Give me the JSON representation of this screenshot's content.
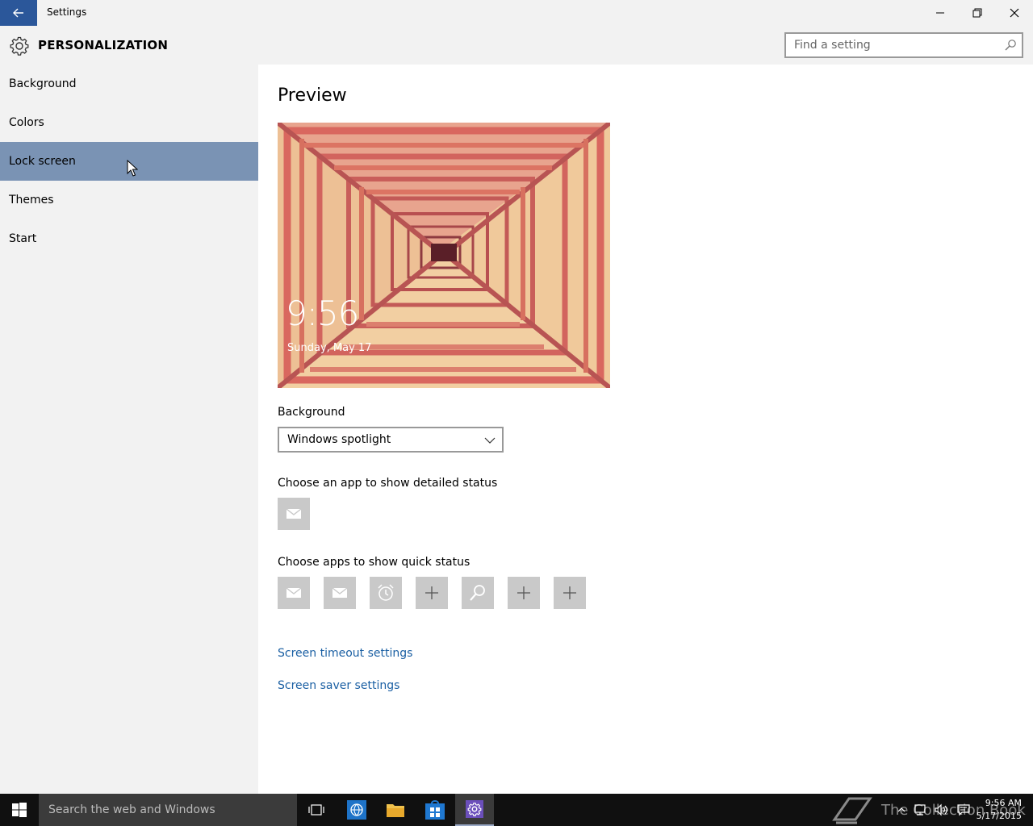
{
  "window": {
    "title": "Settings"
  },
  "header": {
    "section_title": "PERSONALIZATION",
    "search_placeholder": "Find a setting"
  },
  "sidebar": {
    "items": [
      {
        "label": "Background",
        "selected": false
      },
      {
        "label": "Colors",
        "selected": false
      },
      {
        "label": "Lock screen",
        "selected": true
      },
      {
        "label": "Themes",
        "selected": false
      },
      {
        "label": "Start",
        "selected": false
      }
    ]
  },
  "main": {
    "preview_title": "Preview",
    "preview_time": "9:56",
    "preview_date": "Sunday, May 17",
    "background_label": "Background",
    "background_value": "Windows spotlight",
    "detailed_status_label": "Choose an app to show detailed status",
    "detailed_status_apps": [
      "mail-icon"
    ],
    "quick_status_label": "Choose apps to show quick status",
    "quick_status_apps": [
      "mail-icon",
      "mail-icon",
      "alarm-icon",
      "plus-icon",
      "search-icon",
      "plus-icon",
      "plus-icon"
    ],
    "links": {
      "screen_timeout": "Screen timeout settings",
      "screen_saver": "Screen saver settings"
    }
  },
  "taskbar": {
    "search_text": "Search the web and Windows",
    "watermark": "The Collection Book",
    "clock_time": "9:56 AM",
    "clock_date": "5/17/2015"
  },
  "colors": {
    "accent": "#2b579a",
    "selected_nav": "#7a93b4",
    "link": "#1a5fa3",
    "chrome_bg": "#f2f2f2",
    "taskbar_bg": "#101010"
  }
}
